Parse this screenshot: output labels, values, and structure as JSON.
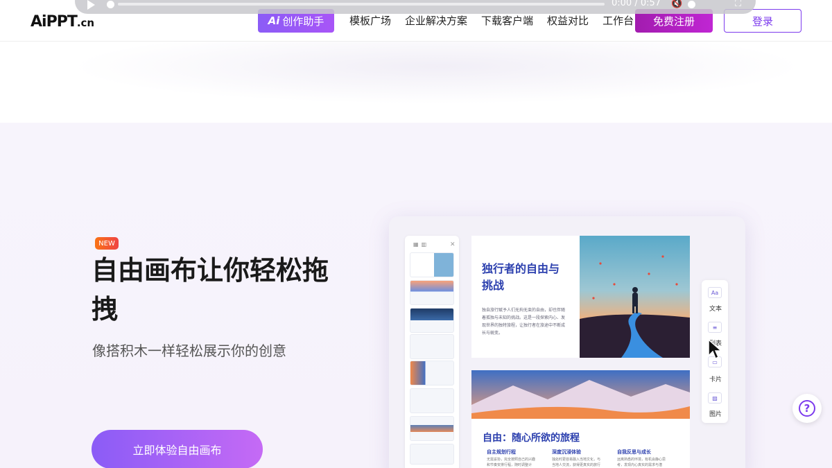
{
  "header": {
    "logo_main": "AiPPT",
    "logo_suffix": ".cn",
    "ai_button_mark": "Ai",
    "ai_button_label": "创作助手",
    "nav": [
      "模板广场",
      "企业解决方案",
      "下载客户端",
      "权益对比",
      "工作台"
    ],
    "register_label": "免费注册",
    "login_label": "登录"
  },
  "video_bar": {
    "time": "0:00 / 0:57",
    "progress": 0
  },
  "hero": {
    "badge": "NEW",
    "title": "自由画布让你轻松拖拽",
    "subtitle": "像搭积木一样轻松展示你的创意",
    "cta_label": "立即体验自由画布"
  },
  "preview": {
    "slide1_title": "独行者的自由与挑战",
    "slide1_body": "独自旅行赋予人们无拘无束的自由，却也伴随着孤独与未知的挑战。这是一段探索内心、发现世界的独特旅程，让独行者在旅途中不断成长与蜕变。",
    "slide2_title": "自由：随心所欲的旅程",
    "columns": [
      {
        "head": "自主规划行程",
        "body": "无需妥协，完全按照自己的兴趣和节奏安排行程，随时调整计划。"
      },
      {
        "head": "深度沉浸体验",
        "body": "独处时更容易融入当地文化，与当地人交流，获得更真实的旅行体验。"
      },
      {
        "head": "自我反思与成长",
        "body": "远离熟悉的环境，有机会静心思考，发现内心真实的需求与潜力。"
      }
    ],
    "tools": [
      "文本",
      "列表",
      "卡片",
      "图片"
    ]
  },
  "colors": {
    "accent": "#7c3aed",
    "register": "#c026d3",
    "slide_title": "#2b3fae"
  }
}
